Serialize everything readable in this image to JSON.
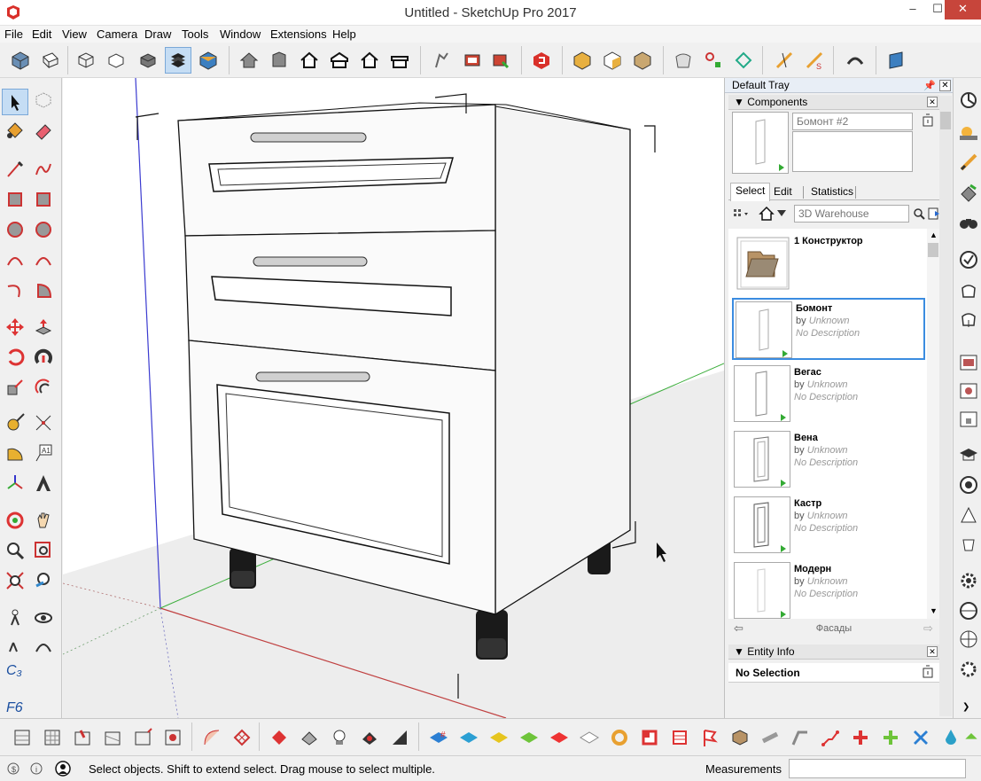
{
  "window": {
    "title": "Untitled - SketchUp Pro 2017",
    "min": "–",
    "max": "☐",
    "close": "✕"
  },
  "menu": [
    "File",
    "Edit",
    "View",
    "Camera",
    "Draw",
    "Tools",
    "Window",
    "Extensions",
    "Help"
  ],
  "tray": {
    "title": "Default Tray",
    "components": {
      "header": "Components",
      "selected_name": "Бомонт #2",
      "tabs": [
        "Select",
        "Edit",
        "Statistics"
      ],
      "search_placeholder": "3D Warehouse",
      "results": [
        {
          "name": "1 Конструктор",
          "type": "folder"
        },
        {
          "name": "Бомонт",
          "by_prefix": "by",
          "by": "Unknown",
          "desc": "No Description",
          "selected": true
        },
        {
          "name": "Вегас",
          "by_prefix": "by",
          "by": "Unknown",
          "desc": "No Description"
        },
        {
          "name": "Вена",
          "by_prefix": "by",
          "by": "Unknown",
          "desc": "No Description"
        },
        {
          "name": "Кастр",
          "by_prefix": "by",
          "by": "Unknown",
          "desc": "No Description"
        },
        {
          "name": "Модерн",
          "by_prefix": "by",
          "by": "Unknown",
          "desc": "No Description"
        }
      ],
      "collection_name": "Фасады"
    },
    "entity_info": {
      "header": "Entity Info",
      "value": "No Selection"
    }
  },
  "status": {
    "hint": "Select objects. Shift to extend select. Drag mouse to select multiple.",
    "measurements_label": "Measurements",
    "measurements_value": ""
  },
  "colors": {
    "selection_blue": "#3b8ce0",
    "axis_red": "#c04040",
    "axis_green": "#3cae3c",
    "axis_blue": "#3b3bd0",
    "ground": "#e8e8e8"
  }
}
